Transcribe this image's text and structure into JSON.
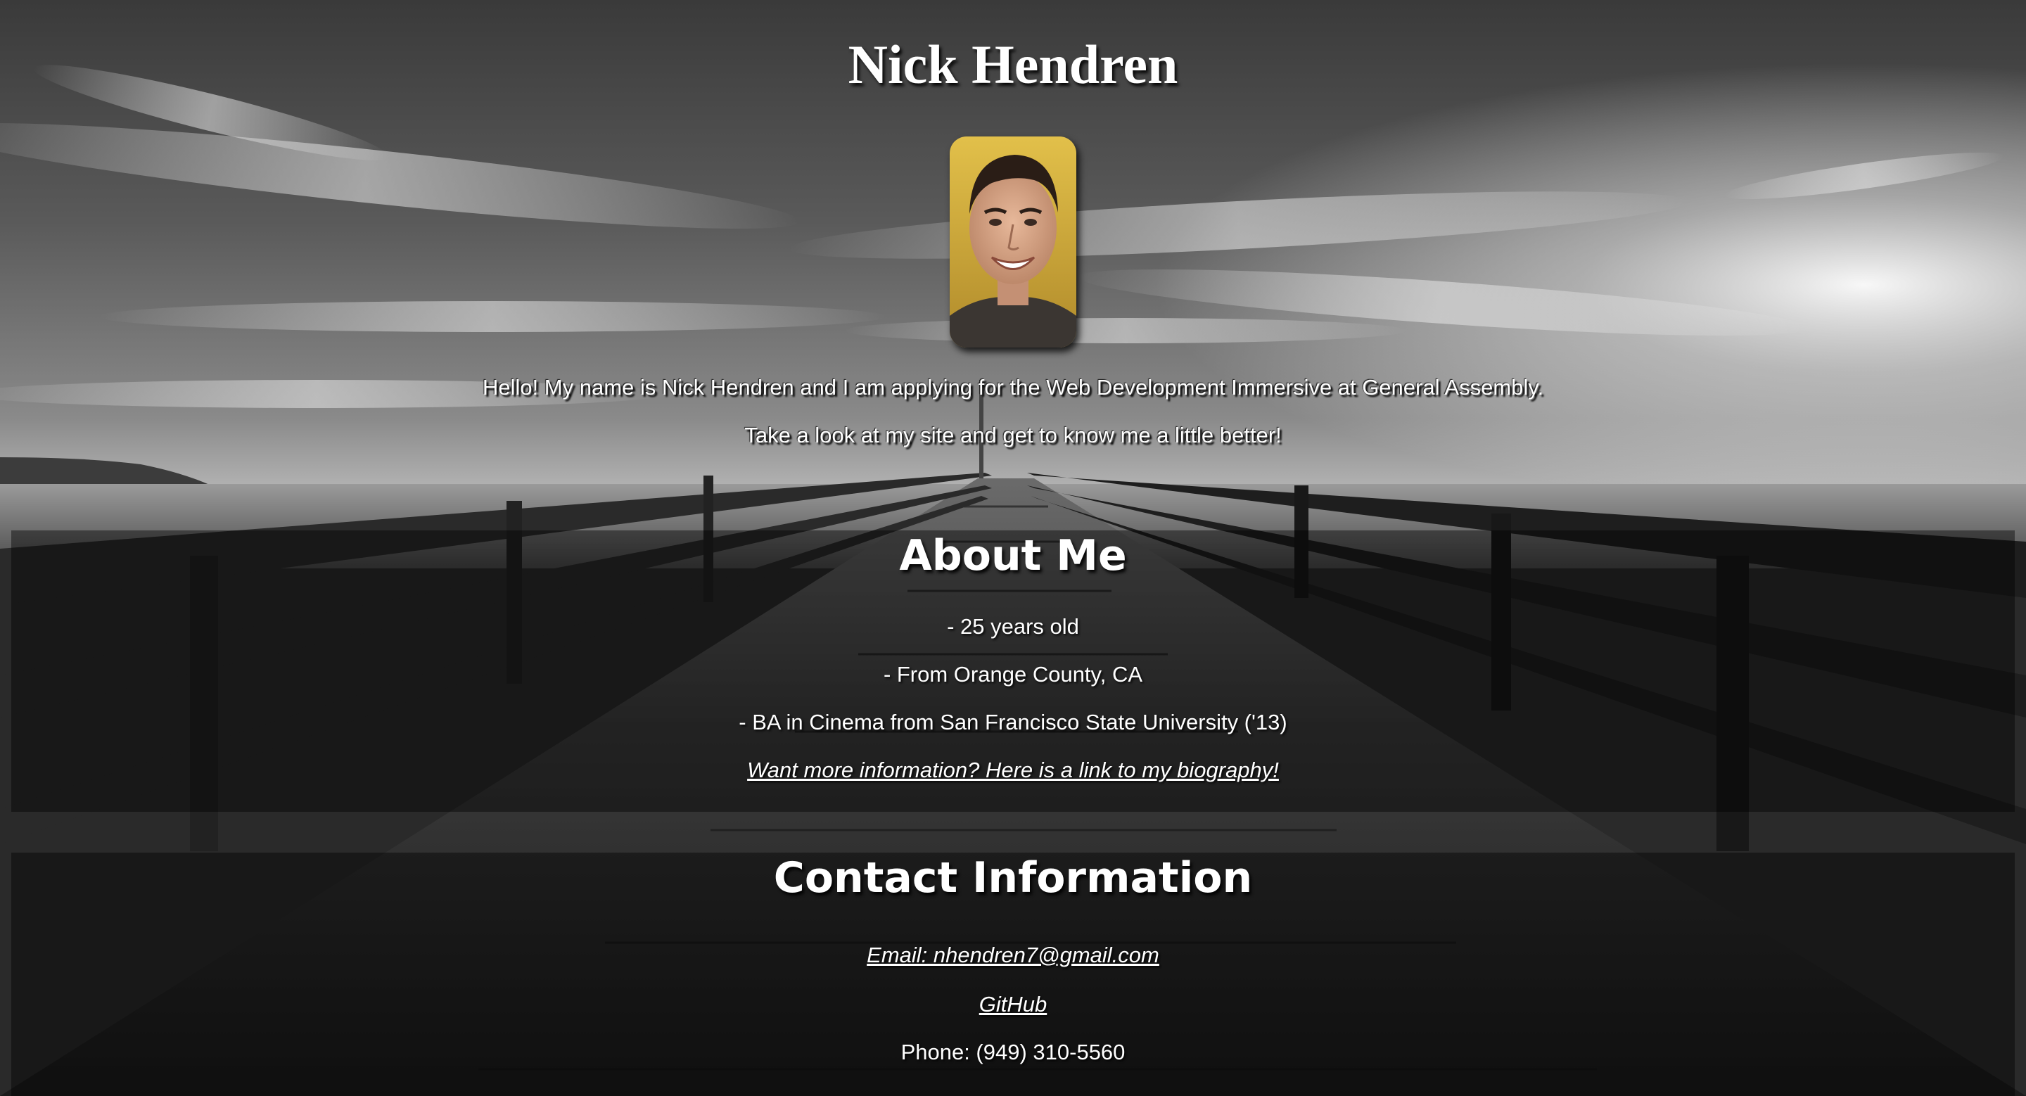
{
  "header": {
    "name": "Nick Hendren",
    "intro_line_1": "Hello! My name is Nick Hendren and I am applying for the Web Development Immersive at General Assembly.",
    "intro_line_2": "Take a look at my site and get to know me a little better!"
  },
  "about": {
    "heading": "About Me",
    "facts": [
      "- 25 years old",
      "- From Orange County, CA",
      "- BA in Cinema from San Francisco State University ('13)"
    ],
    "bio_link": "Want more information? Here is a link to my biography!"
  },
  "contact": {
    "heading": "Contact Information",
    "email_link": "Email: nhendren7@gmail.com",
    "github_link": "GitHub",
    "phone": "Phone: (949) 310-5560"
  },
  "colors": {
    "text": "#ffffff",
    "panel": "rgba(0,0,0,0.42)",
    "avatar_background": "#d9b43c"
  },
  "icons": {
    "background": "pier-photo",
    "avatar": "profile-photo"
  }
}
